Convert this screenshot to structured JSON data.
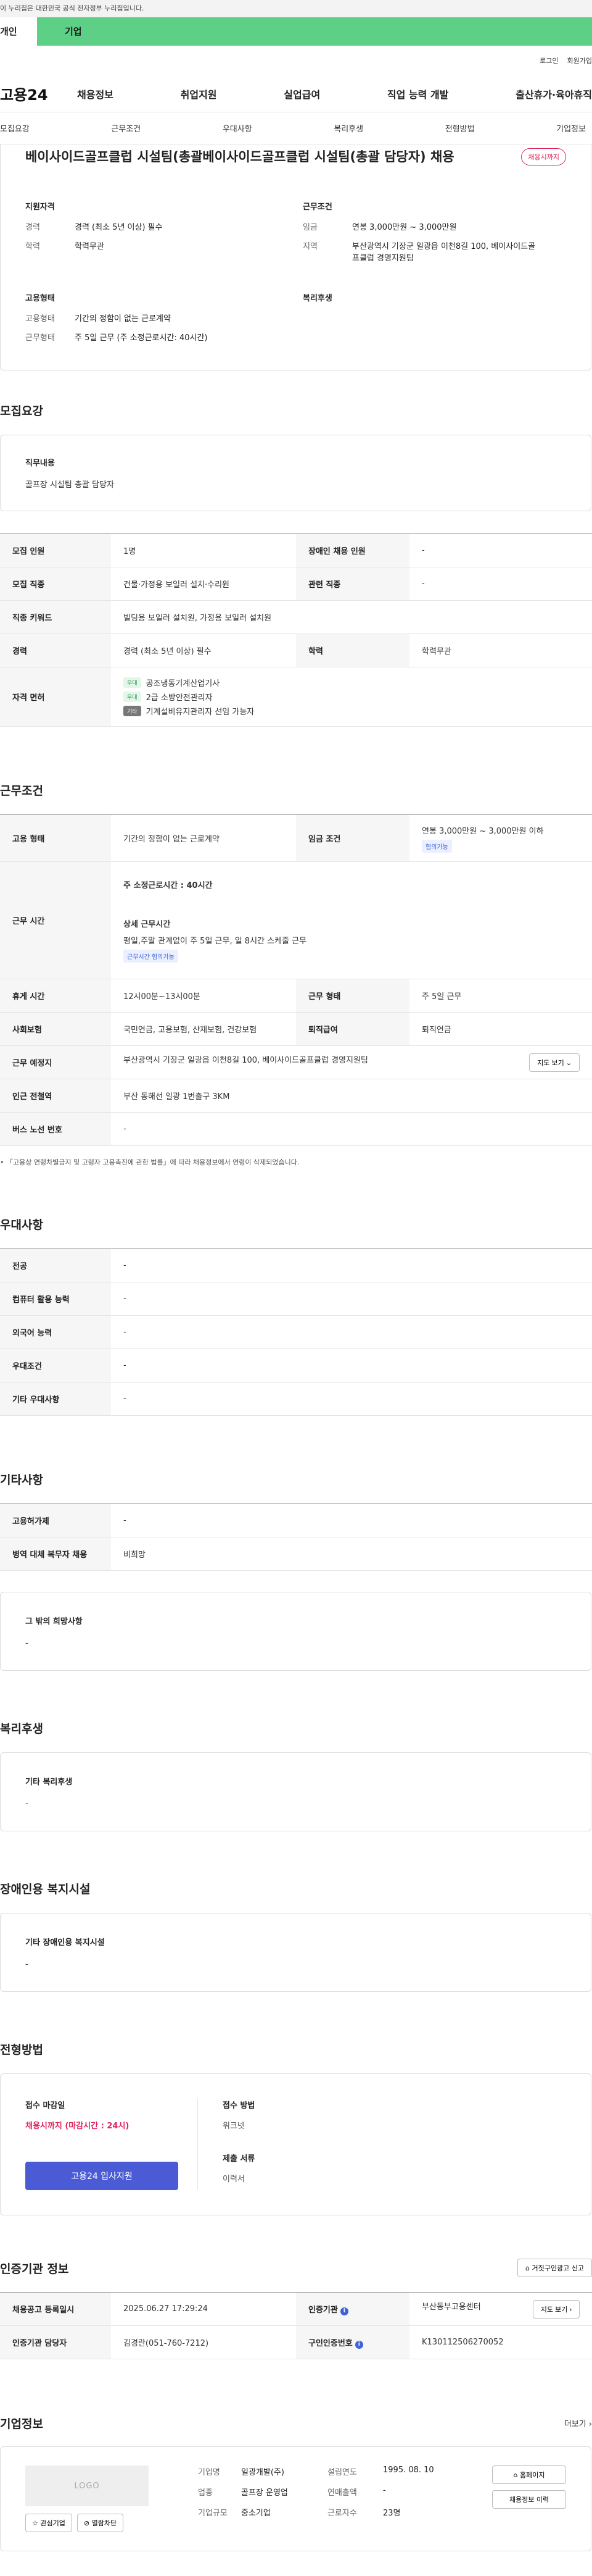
{
  "gov_banner": "이 누리집은 대한민국 공식 전자정부 누리집입니다.",
  "user_tabs": {
    "person": "개인",
    "company": "기업"
  },
  "util_links": {
    "login": "로그인",
    "join": "회원가입"
  },
  "site_logo": "고용24",
  "gnb": [
    "채용정보",
    "취업지원",
    "실업급여",
    "직업 능력 개발",
    "출산휴가·육아휴직"
  ],
  "subnav": [
    "모집요강",
    "근무조건",
    "우대사항",
    "복리후생",
    "전형방법",
    "기업정보"
  ],
  "summary": {
    "title": "베이사이드골프클럽 시설팀(총괄베이사이드골프클럽 시설팀(총괄 담당자) 채용",
    "deadline_badge": "채용시까지",
    "qualification": {
      "heading": "지원자격",
      "rows": [
        {
          "k": "경력",
          "v": "경력 (최소 5년 이상) 필수"
        },
        {
          "k": "학력",
          "v": "학력무관"
        }
      ]
    },
    "conditions": {
      "heading": "근무조건",
      "rows": [
        {
          "k": "임금",
          "v": "연봉 3,000만원 ~ 3,000만원"
        },
        {
          "k": "지역",
          "v": "부산광역시 기장군 일광읍 이천8길 100, 베이사이드골프클럽 경영지원팀"
        }
      ]
    },
    "employment": {
      "heading": "고용형태",
      "rows": [
        {
          "k": "고용형태",
          "v": "기간의 정함이 없는 근로계약"
        },
        {
          "k": "근무형태",
          "v": "주 5일 근무 (주 소정근로시간: 40시간)"
        }
      ]
    },
    "welfare_heading": "복리후생"
  },
  "recruit": {
    "title": "모집요강",
    "duty_heading": "직무내용",
    "duty_text": "골프장 시설팀 총괄 담당자",
    "rows": {
      "headcount_k": "모집 인원",
      "headcount_v": "1명",
      "disabled_k": "장애인 채용 인원",
      "disabled_v": "-",
      "job_k": "모집 직종",
      "job_v": "건물·가정용 보일러 설치·수리원",
      "related_k": "관련 직종",
      "related_v": "-",
      "keyword_k": "직종 키워드",
      "keyword_v": "빌딩용 보일러 설치원, 가정용 보일러 설치원",
      "career_k": "경력",
      "career_v": "경력 (최소 5년 이상) 필수",
      "edu_k": "학력",
      "edu_v": "학력무관",
      "license_k": "자격 면허"
    },
    "licenses": [
      {
        "tag": "우대",
        "name": "공조냉동기계산업기사"
      },
      {
        "tag": "우대",
        "name": "2급 소방안전관리자"
      },
      {
        "tag": "기타",
        "name": "기계설비유지관리자 선임 가능자"
      }
    ]
  },
  "work": {
    "title": "근무조건",
    "type_k": "고용 형태",
    "type_v": "기간의 정함이 없는 근로계약",
    "wage_k": "임금 조건",
    "wage_v": "연봉 3,000만원 ~ 3,000만원 이하",
    "wage_tag": "협의가능",
    "hours_k": "근무 시간",
    "hours_main": "주 소정근로시간 : 40시간",
    "hours_detail_h": "상세 근무시간",
    "hours_detail": "평일,주말 관계없이 주 5일 근무, 일 8시간 스케줄 근무",
    "hours_tag": "근무시간 협의가능",
    "break_k": "휴게 시간",
    "break_v": "12시00분~13시00분",
    "form_k": "근무 형태",
    "form_v": "주 5일 근무",
    "insurance_k": "사회보험",
    "insurance_v": "국민연금, 고용보험, 산재보험, 건강보험",
    "severance_k": "퇴직급여",
    "severance_v": "퇴직연금",
    "place_k": "근무 예정지",
    "place_v": "부산광역시 기장군 일광읍 이천8길 100, 베이사이드골프클럽 경영지원팀",
    "map_btn": "지도 보기 ⌄",
    "station_k": "인근 전철역",
    "station_v": "부산 동해선 일광 1번출구 3KM",
    "bus_k": "버스 노선 번호",
    "bus_v": "-",
    "footnote": "「고용상 연령차별금지 및 고령자 고용촉진에 관한 법률」에 따라 채용정보에서 연령이 삭제되었습니다."
  },
  "preference": {
    "title": "우대사항",
    "rows": [
      {
        "k": "전공",
        "v": "-"
      },
      {
        "k": "컴퓨터 활용 능력",
        "v": "-"
      },
      {
        "k": "외국어 능력",
        "v": "-"
      },
      {
        "k": "우대조건",
        "v": "-"
      },
      {
        "k": "기타 우대사항",
        "v": "-"
      }
    ]
  },
  "etc": {
    "title": "기타사항",
    "rows": [
      {
        "k": "고용허가제",
        "v": "-"
      },
      {
        "k": "병역 대체 복무자 채용",
        "v": "비희망"
      }
    ],
    "other_heading": "그 밖의 희망사항",
    "other_value": "-"
  },
  "welfare": {
    "title": "복리후생",
    "heading": "기타 복리후생",
    "value": "-"
  },
  "disabled_facility": {
    "title": "장애인용 복지시설",
    "heading": "기타 장애인용 복지시설",
    "value": "-"
  },
  "apply": {
    "title": "전형방법",
    "deadline_h": "접수 마감일",
    "deadline_v": "채용시까지 (마감시간 : 24시)",
    "method_h": "접수 방법",
    "method_v": "워크넷",
    "docs_h": "제출 서류",
    "docs_v": "이력서",
    "apply_btn": "고용24 입사지원"
  },
  "auth": {
    "title": "인증기관 정보",
    "report_btn": "거짓구인광고 신고",
    "reg_k": "채용공고 등록일시",
    "reg_v": "2025.06.27 17:29:24",
    "org_k": "인증기관",
    "org_v": "부산동부고용센터",
    "map_btn": "지도 보기 ›",
    "manager_k": "인증기관 담당자",
    "manager_v": "김경란(051-760-7212)",
    "no_k": "구인인증번호",
    "no_v": "K130112506270052"
  },
  "company": {
    "title": "기업정보",
    "more": "더보기 ›",
    "logo_text": "LOGO",
    "fav_btn": "관심기업",
    "block_btn": "열람차단",
    "info": [
      {
        "k": "기업명",
        "v": "일광개발(주)"
      },
      {
        "k": "설립연도",
        "v": "1995. 08. 10"
      },
      {
        "k": "업종",
        "v": "골프장 운영업"
      },
      {
        "k": "연매출액",
        "v": "-"
      },
      {
        "k": "기업규모",
        "v": "중소기업"
      },
      {
        "k": "근로자수",
        "v": "23명"
      }
    ],
    "home_btn": "홈페이지",
    "history_btn": "채용정보 이력"
  }
}
